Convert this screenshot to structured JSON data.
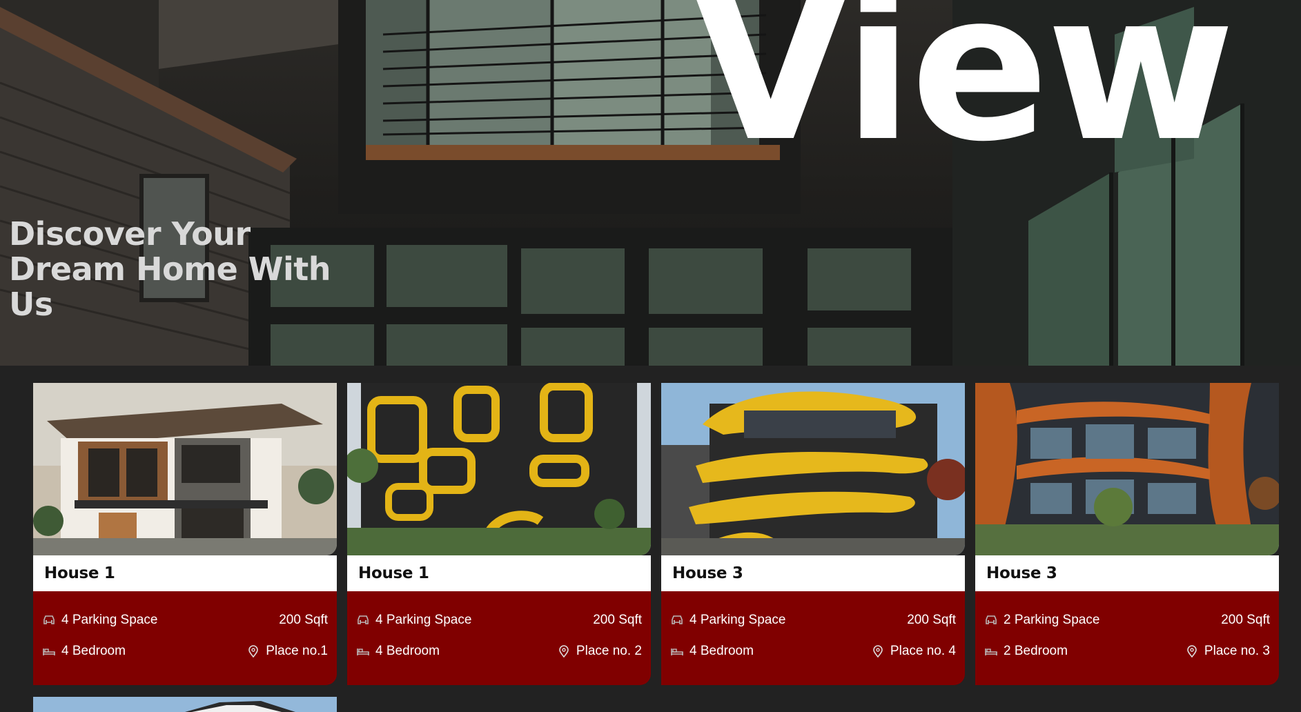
{
  "hero": {
    "title": "View",
    "subtitle": "Discover Your Dream Home With Us"
  },
  "colors": {
    "page_background": "#222222",
    "card_info_background": "#800000",
    "card_name_background": "#ffffff",
    "hero_title": "#ffffff",
    "hero_subtitle": "#d9d9d9"
  },
  "cards": [
    {
      "name": "House 1",
      "parking": "4 Parking Space",
      "area": "200 Sqft",
      "bedrooms": "4 Bedroom",
      "place": "Place no.1",
      "image": "modern-two-storey-house-photo"
    },
    {
      "name": "House 1",
      "parking": "4 Parking Space",
      "area": "200 Sqft",
      "bedrooms": "4 Bedroom",
      "place": "Place no. 2",
      "image": "black-yellow-futuristic-building-photo"
    },
    {
      "name": "House 3",
      "parking": "4 Parking Space",
      "area": "200 Sqft",
      "bedrooms": "4 Bedroom",
      "place": "Place no. 4",
      "image": "yellow-wave-building-photo"
    },
    {
      "name": "House 3",
      "parking": "2 Parking Space",
      "area": "200 Sqft",
      "bedrooms": "2 Bedroom",
      "place": "Place no. 3",
      "image": "copper-glass-apartment-photo"
    }
  ],
  "icons": {
    "parking": "car-icon",
    "bedroom": "bed-icon",
    "place": "map-pin-icon"
  }
}
